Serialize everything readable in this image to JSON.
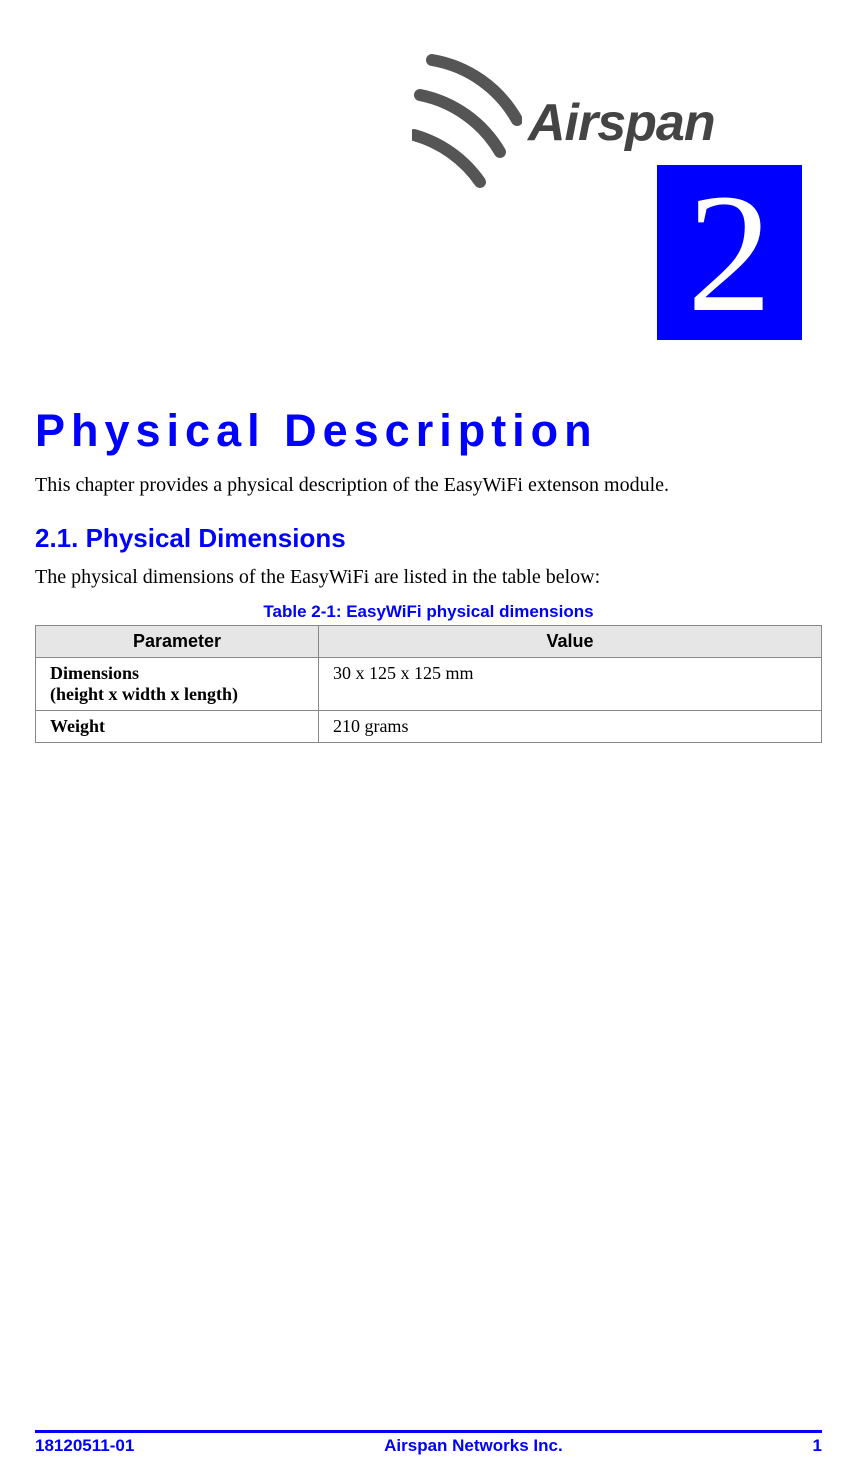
{
  "header": {
    "brand_name": "Airspan",
    "chapter_number": "2"
  },
  "content": {
    "chapter_title": "Physical Description",
    "intro_paragraph": "This chapter provides a physical description of the EasyWiFi extenson module.",
    "section_heading": "2.1. Physical Dimensions",
    "section_intro": "The physical dimensions of the EasyWiFi are listed in the table below:",
    "table_caption": "Table 2-1:  EasyWiFi physical dimensions",
    "table": {
      "headers": {
        "col1": "Parameter",
        "col2": "Value"
      },
      "rows": [
        {
          "param_line1": "Dimensions",
          "param_line2": "(height x width x length)",
          "value": "30 x 125 x 125 mm"
        },
        {
          "param_line1": "Weight",
          "param_line2": "",
          "value": "210 grams"
        }
      ]
    }
  },
  "footer": {
    "left": "18120511-01",
    "center": "Airspan Networks Inc.",
    "right": "1"
  }
}
